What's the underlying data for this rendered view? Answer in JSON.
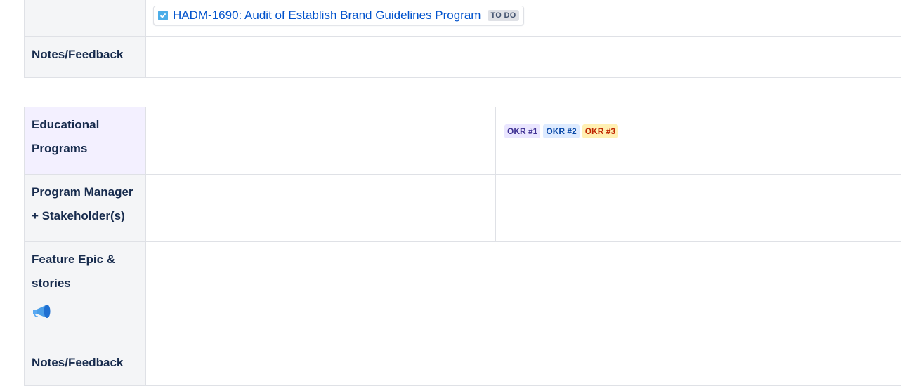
{
  "table1": {
    "jira_issue": {
      "key_and_title": "HADM-1690: Audit of Establish Brand Guidelines Program",
      "status": "TO DO"
    },
    "notes_header": "Notes/Feedback"
  },
  "table2": {
    "educational_programs_header": [
      "Educational",
      "Programs"
    ],
    "okr_lozenges": [
      "OKR #1",
      "OKR #2",
      "OKR #3"
    ],
    "program_manager_header": [
      "Program Manager",
      "+ Stakeholder(s)"
    ],
    "feature_epic_header": [
      "Feature Epic &",
      "stories"
    ],
    "megaphone_icon": "megaphone-icon",
    "notes_header": "Notes/Feedback"
  },
  "colors": {
    "link": "#0052cc",
    "checkbox": "#4bade8",
    "header_bg": "#f4f5f7",
    "highlight_header_bg": "#f3f0ff"
  }
}
